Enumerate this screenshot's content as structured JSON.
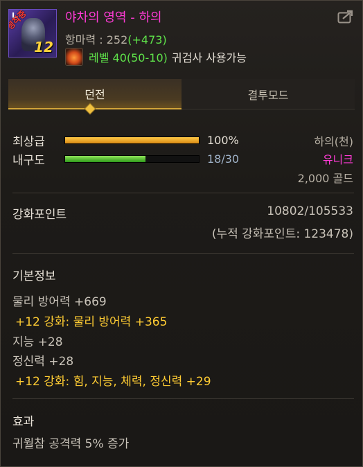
{
  "item": {
    "icon_corner_text": "L",
    "icon_badge": "정착중",
    "enhance_level": "12",
    "name": "야차의 영역 - 하의",
    "attack_label": "항마력 : ",
    "attack_base": "252",
    "attack_bonus": "(+473)",
    "req_level": "레벨 40(50-10)",
    "req_class": "귀검사 사용가능",
    "class_icon": "flame-class-icon",
    "share_icon": "share-icon"
  },
  "tabs": [
    {
      "label": "던전",
      "active": true
    },
    {
      "label": "결투모드",
      "active": false
    }
  ],
  "stats": {
    "grade_label": "최상급",
    "grade_value": "100%",
    "grade_fill": 1.0,
    "durability_label": "내구도",
    "durability_value": "18/30",
    "durability_fill": 0.6
  },
  "meta": {
    "slot": "하의(천)",
    "rarity": "유니크",
    "rarity_color": "#ff3bd6",
    "price": "2,000 골드"
  },
  "enhance": {
    "title": "강화포인트",
    "points": "10802/105533",
    "cumulative": "(누적 강화포인트: 123478)"
  },
  "basic": {
    "title": "기본정보",
    "lines": [
      {
        "text": "물리 방어력 +669",
        "gold": false
      },
      {
        "text": "+12 강화: 물리 방어력 +365",
        "gold": true
      },
      {
        "text": "지능 +28",
        "gold": false
      },
      {
        "text": "정신력 +28",
        "gold": false
      },
      {
        "text": "+12 강화: 힘, 지능, 체력, 정신력 +29",
        "gold": true
      }
    ]
  },
  "effect": {
    "title": "효과",
    "lines": [
      "귀월참 공격력 5% 증가"
    ]
  },
  "colors": {
    "name": "#ff3bd6",
    "bonus_green": "#5fe34a",
    "gold": "#ffcc33",
    "tab_accent": "#d3a53a"
  }
}
